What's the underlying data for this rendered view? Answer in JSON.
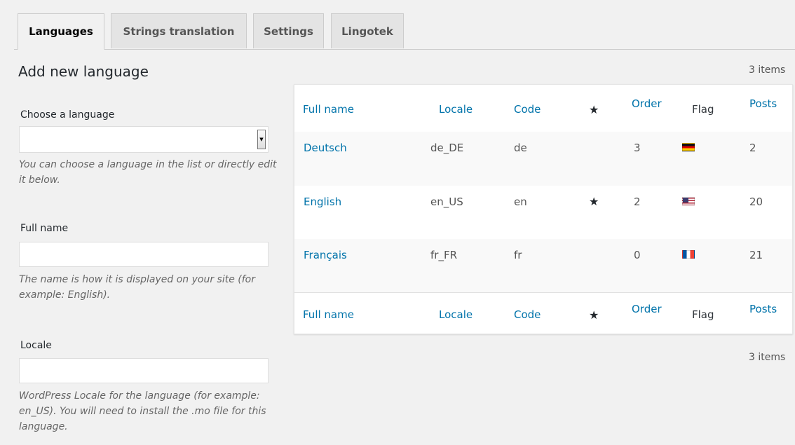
{
  "tabs": [
    "Languages",
    "Strings translation",
    "Settings",
    "Lingotek"
  ],
  "form": {
    "title": "Add new language",
    "choose_label": "Choose a language",
    "choose_help": "You can choose a language in the list or directly edit it below.",
    "fullname_label": "Full name",
    "fullname_help": "The name is how it is displayed on your site (for example: English).",
    "locale_label": "Locale",
    "locale_help": "WordPress Locale for the language (for example: en_US). You will need to install the .mo file for this language."
  },
  "table": {
    "count_top": "3 items",
    "count_bottom": "3 items",
    "headers": {
      "full_name": "Full name",
      "locale": "Locale",
      "code": "Code",
      "default": "★",
      "order": "Order",
      "flag": "Flag",
      "posts": "Posts"
    },
    "rows": [
      {
        "name": "Deutsch",
        "locale": "de_DE",
        "code": "de",
        "default": "",
        "order": "3",
        "flag": "flag-de",
        "posts": "2"
      },
      {
        "name": "English",
        "locale": "en_US",
        "code": "en",
        "default": "★",
        "order": "2",
        "flag": "flag-us",
        "posts": "20"
      },
      {
        "name": "Français",
        "locale": "fr_FR",
        "code": "fr",
        "default": "",
        "order": "0",
        "flag": "flag-fr",
        "posts": "21"
      }
    ]
  },
  "colors": {
    "link": "#0073aa",
    "background": "#f1f1f1",
    "table_bg": "#ffffff",
    "alt_row": "#f9f9f9"
  }
}
